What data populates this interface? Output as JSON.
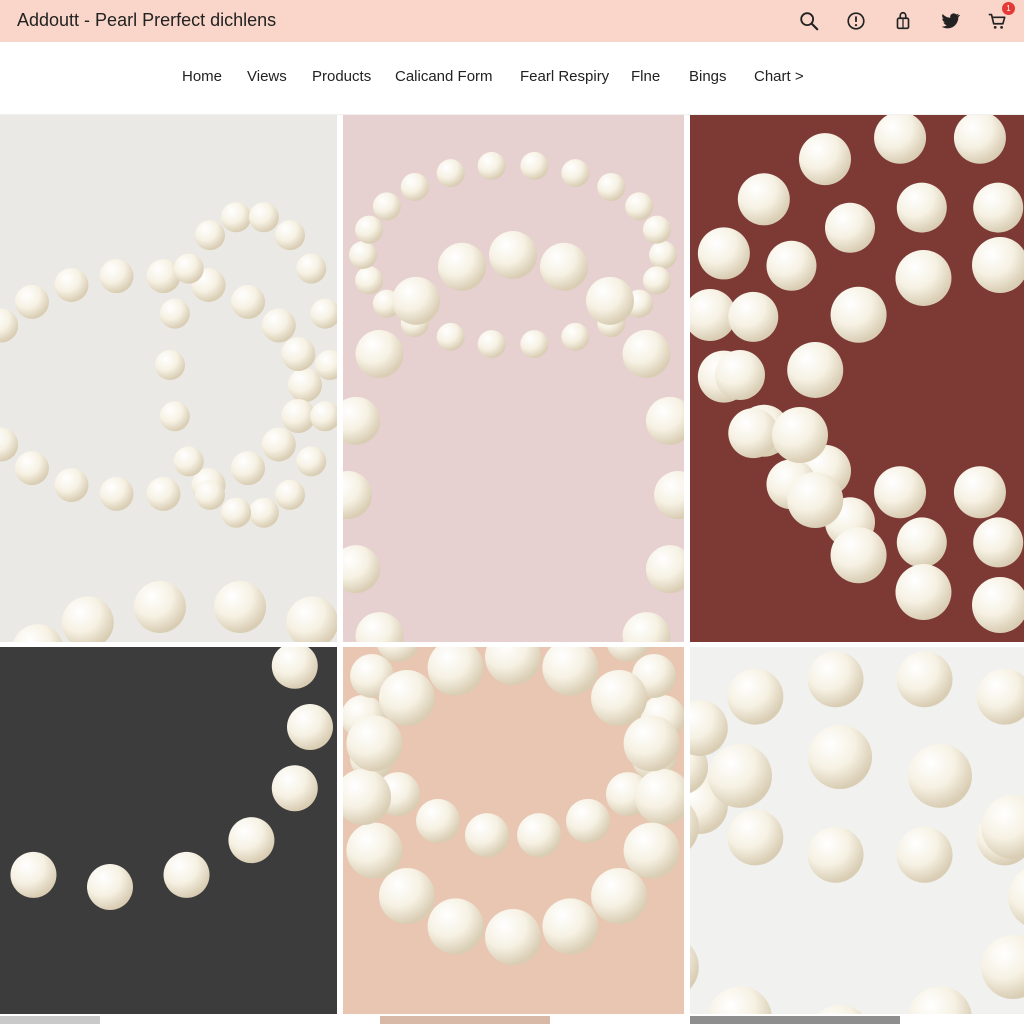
{
  "header": {
    "title": "Addoutt - Pearl Prerfect dichlens",
    "cart_badge": "1"
  },
  "icons": {
    "search": "search-icon",
    "info": "info-icon",
    "bag": "shopping-bag-icon",
    "twitter": "twitter-icon",
    "cart": "cart-icon"
  },
  "nav": {
    "items": [
      {
        "label": "Home"
      },
      {
        "label": "Views"
      },
      {
        "label": "Products"
      },
      {
        "label": "Calicand Form"
      },
      {
        "label": "Fearl Respiry"
      },
      {
        "label": "Flne"
      },
      {
        "label": "Bings"
      },
      {
        "label": "Chart >"
      }
    ]
  },
  "gallery": {
    "tiles": [
      {
        "name": "pearl-tile-1",
        "background": "#ebe9e5"
      },
      {
        "name": "pearl-tile-2",
        "background": "#e6d0d0"
      },
      {
        "name": "pearl-tile-3",
        "background": "#7d3a35"
      },
      {
        "name": "pearl-tile-4",
        "background": "#3c3c3c"
      },
      {
        "name": "pearl-tile-5",
        "background": "#e8c6b1"
      },
      {
        "name": "pearl-tile-6",
        "background": "#f1f1ef"
      }
    ]
  },
  "colors": {
    "topbar": "#f9d6c9",
    "badge": "#e53935",
    "pearl": "#f6f1e3"
  }
}
